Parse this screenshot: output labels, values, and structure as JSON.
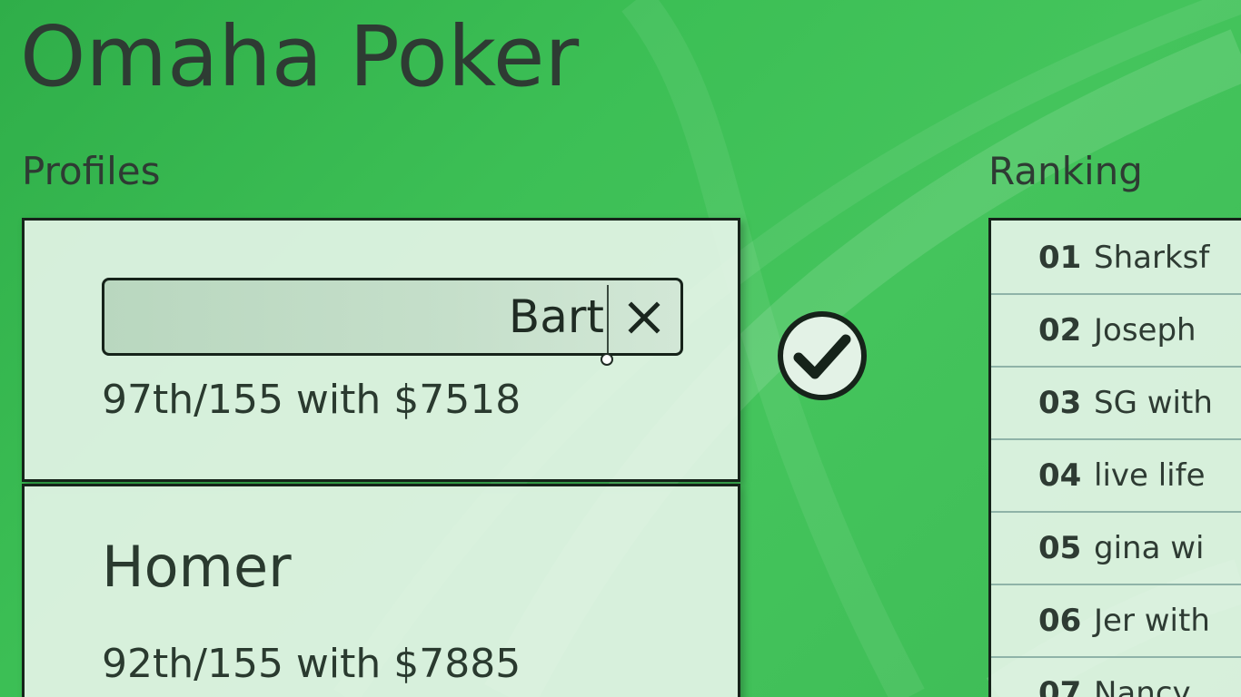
{
  "app": {
    "title": "Omaha Poker"
  },
  "profiles": {
    "label": "Profiles",
    "editing": {
      "name_value": "Bart",
      "stats": "97th/155 with $7518"
    },
    "items": [
      {
        "name": "Homer",
        "stats": "92th/155 with $7885"
      }
    ]
  },
  "ranking": {
    "label": "Ranking",
    "items": [
      {
        "rank": "01",
        "text": "Sharksf"
      },
      {
        "rank": "02",
        "text": "Joseph"
      },
      {
        "rank": "03",
        "text": "SG with"
      },
      {
        "rank": "04",
        "text": "live life"
      },
      {
        "rank": "05",
        "text": "gina wi"
      },
      {
        "rank": "06",
        "text": "Jer with"
      },
      {
        "rank": "07",
        "text": "Nancy"
      }
    ]
  },
  "icons": {
    "clear": "close-icon",
    "confirm": "checkmark-circle-icon"
  },
  "colors": {
    "background": "#3cbf55",
    "card": "#e8f5ea",
    "border": "#16231a",
    "text": "#2e3b33",
    "divider": "#8fb3a8"
  }
}
